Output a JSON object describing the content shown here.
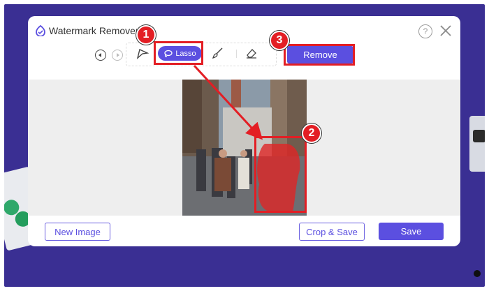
{
  "app": {
    "title": "Watermark Remover",
    "help_glyph": "?",
    "accent": "#5b4fe0",
    "highlight": "#e31e24"
  },
  "toolbar": {
    "lasso_label": "Lasso",
    "remove_label": "Remove"
  },
  "footer": {
    "new_image_label": "New Image",
    "crop_save_label": "Crop & Save",
    "save_label": "Save"
  },
  "annotations": {
    "step1": "1",
    "step2": "2",
    "step3": "3"
  },
  "icons": {
    "logo": "watermark-remover-logo-icon",
    "help": "help-icon",
    "close": "close-icon",
    "undo": "undo-icon",
    "redo": "redo-icon",
    "polygon": "polygonal-lasso-icon",
    "lasso": "lasso-icon",
    "brush": "brush-icon",
    "eraser": "eraser-icon"
  }
}
